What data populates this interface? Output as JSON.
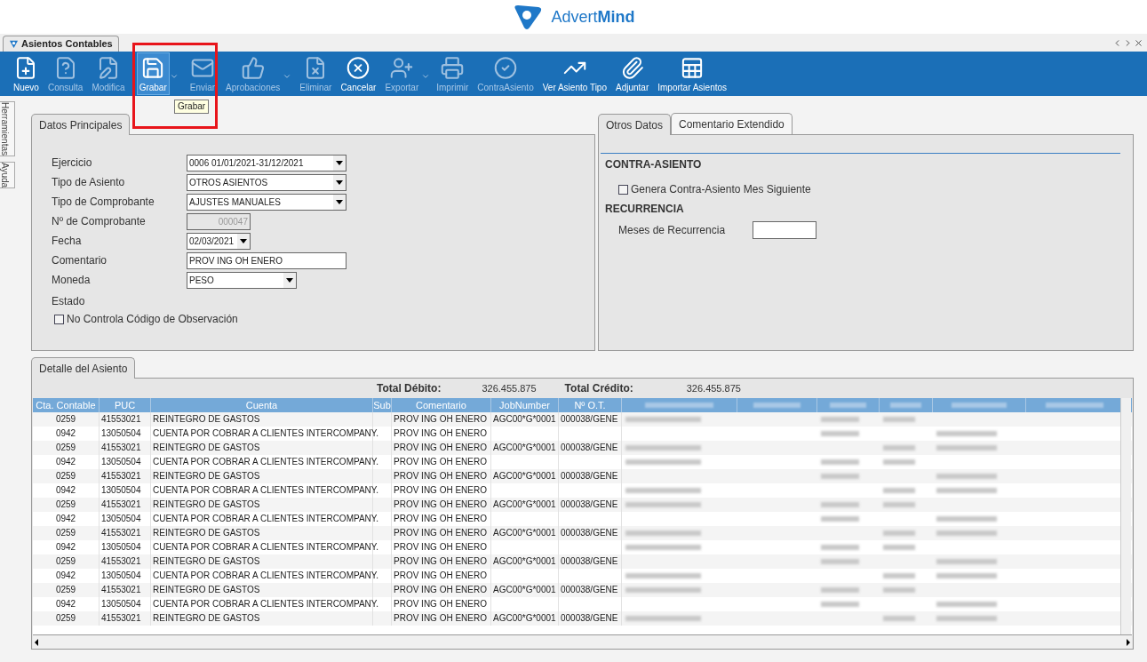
{
  "brand": {
    "name_light": "Advert",
    "name_bold": "Mind"
  },
  "document_tab": {
    "label": "Asientos Contables",
    "selected": true
  },
  "toolbar": [
    {
      "label": "Nuevo",
      "kind": "new",
      "disabled": false,
      "selected": false,
      "caret": false
    },
    {
      "label": "Consulta",
      "kind": "query",
      "disabled": true,
      "selected": false,
      "caret": false
    },
    {
      "label": "Modifica",
      "kind": "edit",
      "disabled": true,
      "selected": false,
      "caret": false
    },
    {
      "label": "Grabar",
      "kind": "save",
      "disabled": false,
      "selected": true,
      "caret": true
    },
    {
      "label": "Enviar",
      "kind": "mail",
      "disabled": true,
      "selected": false,
      "caret": false
    },
    {
      "label": "Aprobaciones",
      "kind": "thumb",
      "disabled": true,
      "selected": false,
      "caret": true
    },
    {
      "label": "Eliminar",
      "kind": "delete",
      "disabled": true,
      "selected": false,
      "caret": false
    },
    {
      "label": "Cancelar",
      "kind": "cancel",
      "disabled": false,
      "selected": false,
      "caret": false
    },
    {
      "label": "Exportar",
      "kind": "user",
      "disabled": true,
      "selected": false,
      "caret": true
    },
    {
      "label": "Imprimir",
      "kind": "print",
      "disabled": true,
      "selected": false,
      "caret": false
    },
    {
      "label": "ContraAsiento",
      "kind": "check",
      "disabled": true,
      "selected": false,
      "caret": false
    },
    {
      "label": "Ver Asiento Tipo",
      "kind": "chart",
      "disabled": false,
      "selected": false,
      "caret": false
    },
    {
      "label": "Adjuntar",
      "kind": "attach",
      "disabled": false,
      "selected": false,
      "caret": false
    },
    {
      "label": "Importar Asientos",
      "kind": "excel",
      "disabled": false,
      "selected": false,
      "caret": false
    }
  ],
  "tooltip": "Grabar",
  "side_tabs": [
    "Herramientas",
    "Ayuda"
  ],
  "main_tabs": [
    {
      "label": "Datos Principales",
      "selected": true
    }
  ],
  "main_fields": [
    {
      "kind": "select",
      "label": "Ejercicio",
      "value": "0006 01/01/2021-31/12/2021",
      "disabled": false
    },
    {
      "kind": "select",
      "label": "Tipo de Asiento",
      "value": "OTROS ASIENTOS",
      "disabled": false
    },
    {
      "kind": "select",
      "label": "Tipo de Comprobante",
      "value": "AJUSTES MANUALES",
      "disabled": false
    },
    {
      "kind": "number",
      "label": "Nº de Comprobante",
      "value": "000047",
      "disabled": true
    },
    {
      "kind": "date",
      "label": "Fecha",
      "value": "02/03/2021",
      "disabled": false
    },
    {
      "kind": "text",
      "label": "Comentario",
      "value": "PROV ING OH ENERO",
      "disabled": false
    },
    {
      "kind": "small_select",
      "label": "Moneda",
      "value": "PESO",
      "disabled": false
    }
  ],
  "estado": {
    "label": "Estado",
    "checkbox": {
      "label": "No Controla Código de Observación",
      "checked": false
    }
  },
  "side_tabs_panel": [
    {
      "label": "Otros Datos",
      "selected": true
    },
    {
      "label": "Comentario Extendido",
      "selected": false
    }
  ],
  "otros": {
    "contra_heading": "CONTRA-ASIENTO",
    "contra_checkbox": {
      "label": "Genera Contra-Asiento Mes Siguiente",
      "checked": false
    },
    "recurrencia_heading": "RECURRENCIA",
    "meses_label": "Meses de Recurrencia"
  },
  "detail_tab": {
    "label": "Detalle del Asiento",
    "selected": true
  },
  "totals": {
    "debit_label": "Total Débito:",
    "debit": "326.455.875",
    "credit_label": "Total Crédito:",
    "credit": "326.455.875"
  },
  "table": {
    "columns": [
      "Cta. Contable",
      "PUC",
      "Cuenta",
      "Sub",
      "Comentario",
      "JobNumber",
      "Nº O.T."
    ],
    "rows": [
      [
        "0259",
        "41553021",
        "REINTEGRO DE GASTOS",
        "",
        "PROV ING OH ENERO",
        "AGC00*G*0001",
        "000038/GENE"
      ],
      [
        "0942",
        "13050504",
        "CUENTA POR COBRAR A CLIENTES INTERCOMPANY.",
        "",
        "PROV ING OH ENERO",
        "",
        ""
      ],
      [
        "0259",
        "41553021",
        "REINTEGRO DE GASTOS",
        "",
        "PROV ING OH ENERO",
        "AGC00*G*0001",
        "000038/GENE"
      ],
      [
        "0942",
        "13050504",
        "CUENTA POR COBRAR A CLIENTES INTERCOMPANY.",
        "",
        "PROV ING OH ENERO",
        "",
        ""
      ],
      [
        "0259",
        "41553021",
        "REINTEGRO DE GASTOS",
        "",
        "PROV ING OH ENERO",
        "AGC00*G*0001",
        "000038/GENE"
      ],
      [
        "0942",
        "13050504",
        "CUENTA POR COBRAR A CLIENTES INTERCOMPANY.",
        "",
        "PROV ING OH ENERO",
        "",
        ""
      ],
      [
        "0259",
        "41553021",
        "REINTEGRO DE GASTOS",
        "",
        "PROV ING OH ENERO",
        "AGC00*G*0001",
        "000038/GENE"
      ],
      [
        "0942",
        "13050504",
        "CUENTA POR COBRAR A CLIENTES INTERCOMPANY.",
        "",
        "PROV ING OH ENERO",
        "",
        ""
      ],
      [
        "0259",
        "41553021",
        "REINTEGRO DE GASTOS",
        "",
        "PROV ING OH ENERO",
        "AGC00*G*0001",
        "000038/GENE"
      ],
      [
        "0942",
        "13050504",
        "CUENTA POR COBRAR A CLIENTES INTERCOMPANY.",
        "",
        "PROV ING OH ENERO",
        "",
        ""
      ],
      [
        "0259",
        "41553021",
        "REINTEGRO DE GASTOS",
        "",
        "PROV ING OH ENERO",
        "AGC00*G*0001",
        "000038/GENE"
      ],
      [
        "0942",
        "13050504",
        "CUENTA POR COBRAR A CLIENTES INTERCOMPANY.",
        "",
        "PROV ING OH ENERO",
        "",
        ""
      ],
      [
        "0259",
        "41553021",
        "REINTEGRO DE GASTOS",
        "",
        "PROV ING OH ENERO",
        "AGC00*G*0001",
        "000038/GENE"
      ],
      [
        "0942",
        "13050504",
        "CUENTA POR COBRAR A CLIENTES INTERCOMPANY.",
        "",
        "PROV ING OH ENERO",
        "",
        ""
      ],
      [
        "0259",
        "41553021",
        "REINTEGRO DE GASTOS",
        "",
        "PROV ING OH ENERO",
        "AGC00*G*0001",
        "000038/GENE"
      ]
    ]
  }
}
